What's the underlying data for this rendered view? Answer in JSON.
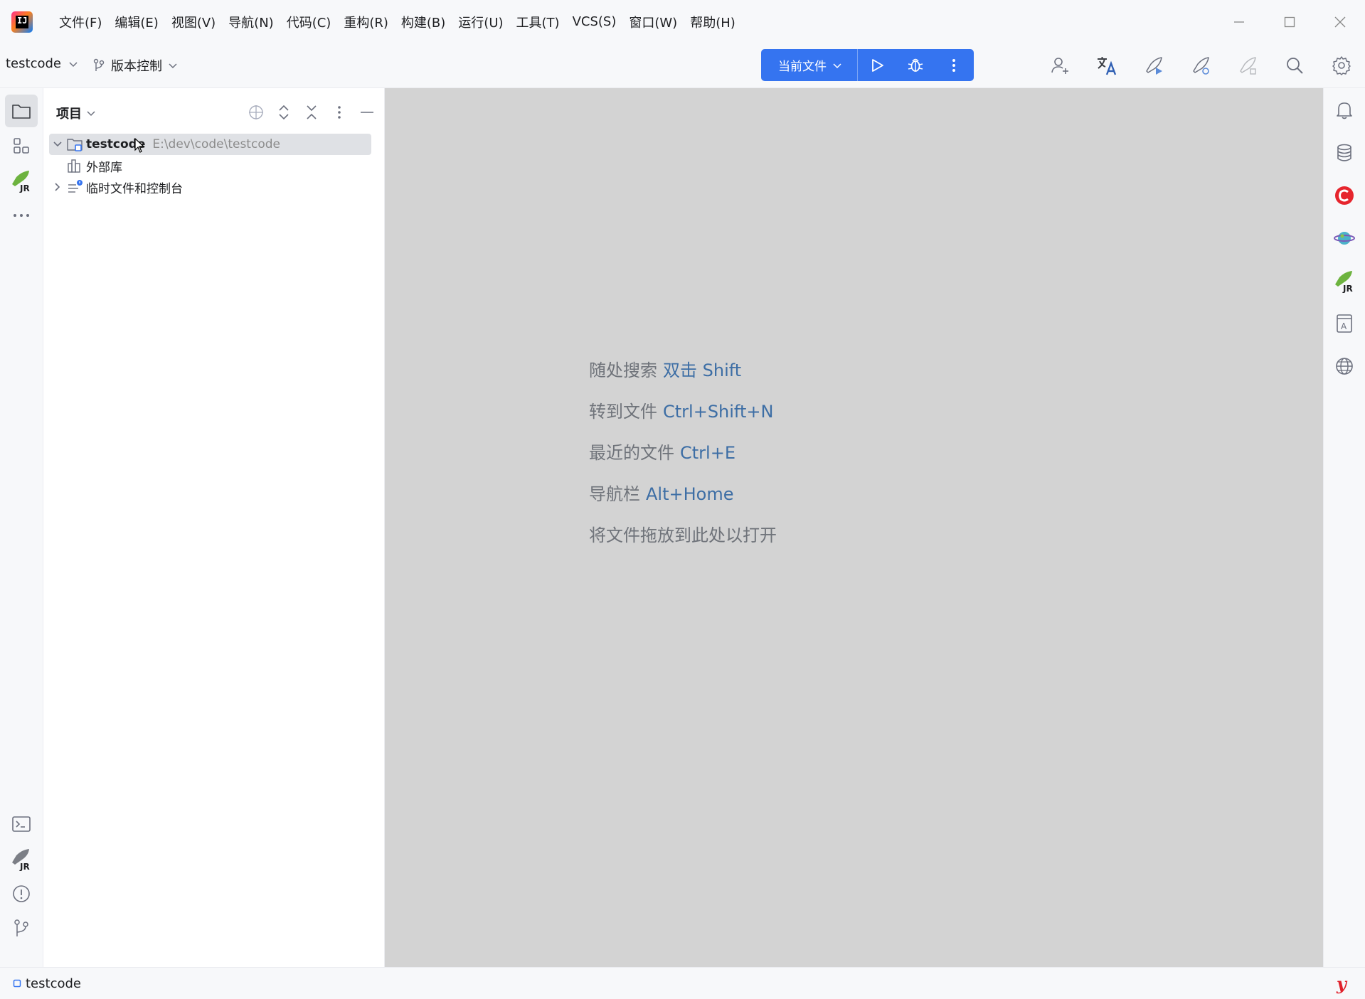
{
  "menubar": {
    "logo_icon": "intellij-idea-icon",
    "items": [
      "文件(F)",
      "编辑(E)",
      "视图(V)",
      "导航(N)",
      "代码(C)",
      "重构(R)",
      "构建(B)",
      "运行(U)",
      "工具(T)",
      "VCS(S)",
      "窗口(W)",
      "帮助(H)"
    ]
  },
  "toolbar": {
    "project_name": "testcode",
    "vcs_label": "版本控制",
    "run_config_label": "当前文件",
    "accent_color": "#3574f0"
  },
  "project_panel": {
    "title": "项目",
    "tree": [
      {
        "label": "testcode",
        "path": "E:\\dev\\code\\testcode",
        "expanded": true,
        "selected": true
      },
      {
        "label": "外部库"
      },
      {
        "label": "临时文件和控制台",
        "expanded": false
      }
    ]
  },
  "editor": {
    "hints": [
      {
        "text": "随处搜索",
        "shortcut": "双击 Shift"
      },
      {
        "text": "转到文件",
        "shortcut": "Ctrl+Shift+N"
      },
      {
        "text": "最近的文件",
        "shortcut": "Ctrl+E"
      },
      {
        "text": "导航栏",
        "shortcut": "Alt+Home"
      },
      {
        "text": "将文件拖放到此处以打开",
        "shortcut": ""
      }
    ]
  },
  "statusbar": {
    "project": "testcode",
    "plugin_glyph": "y"
  }
}
